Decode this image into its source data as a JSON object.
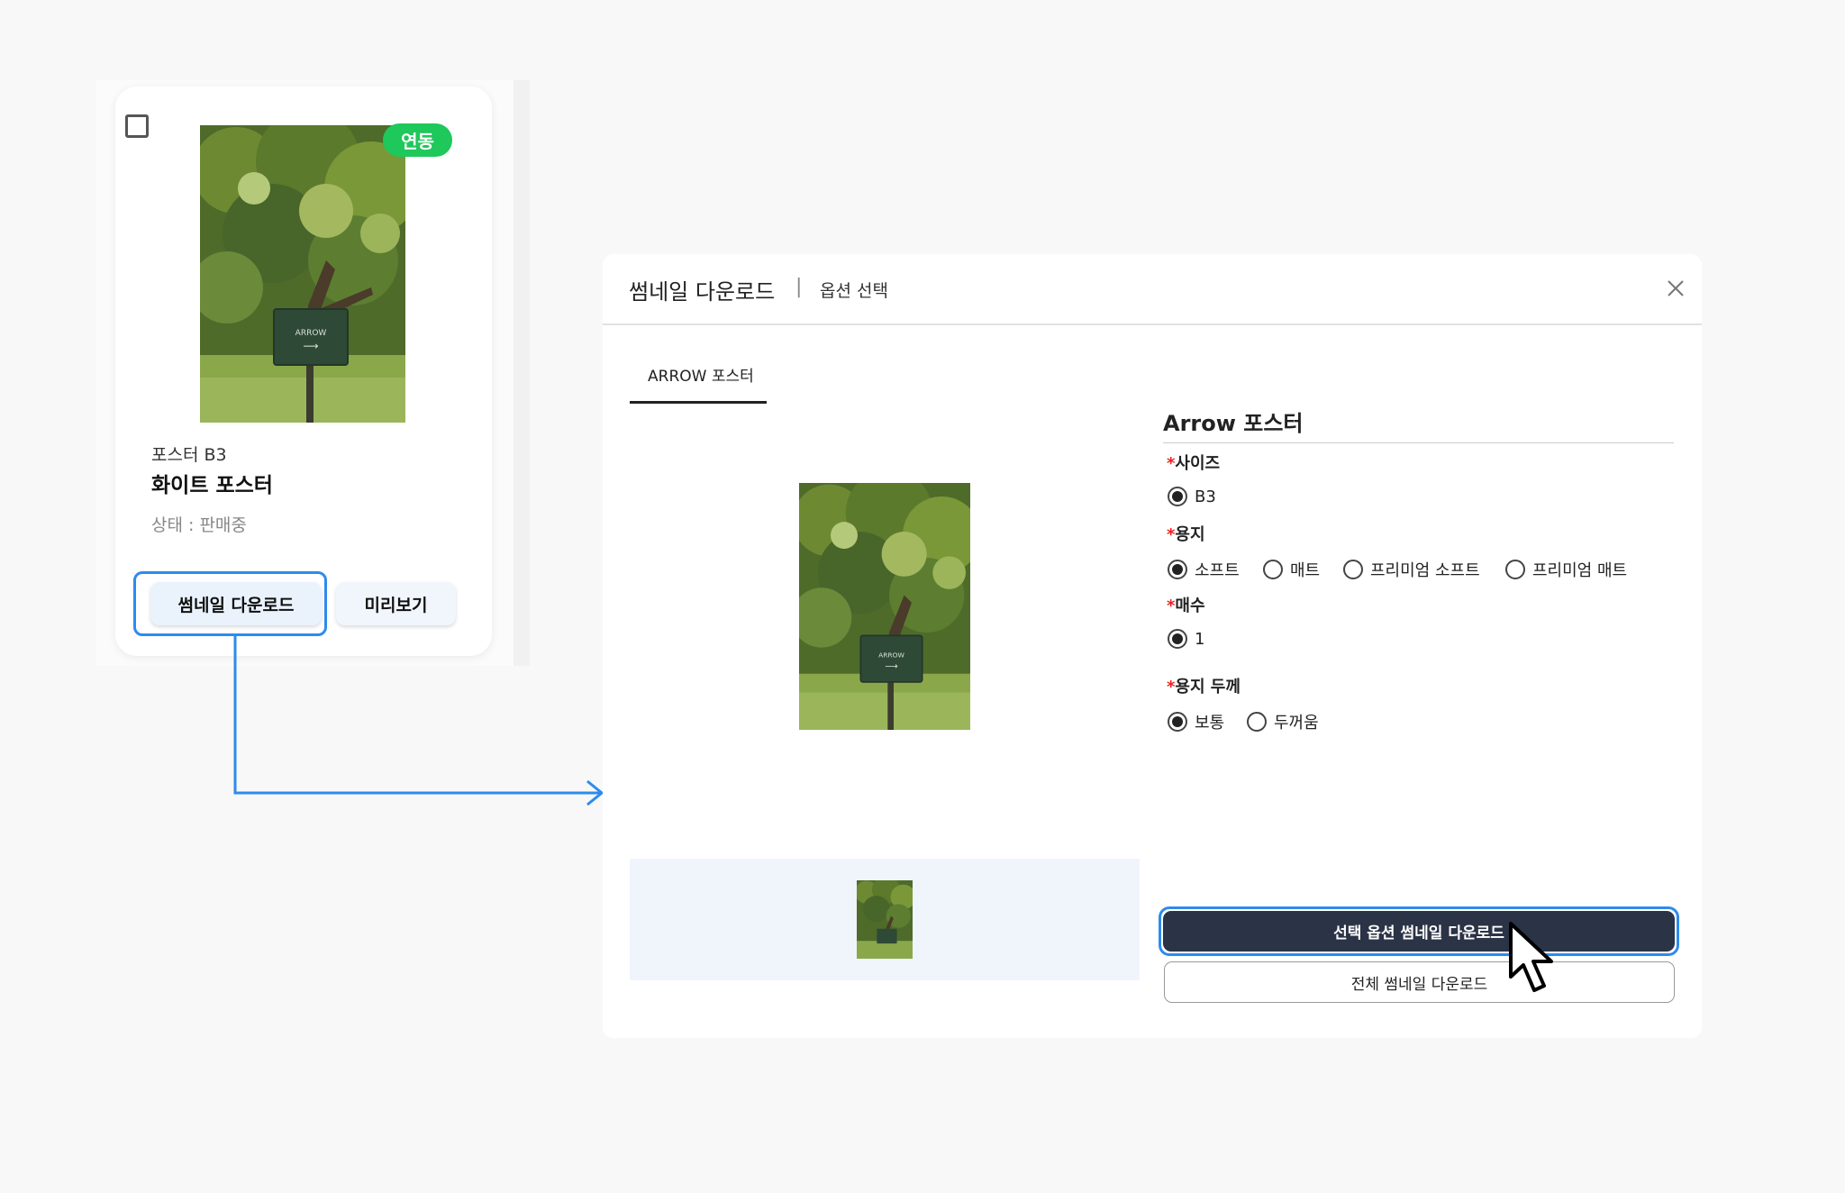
{
  "card": {
    "badge_label": "연동",
    "subtitle": "포스터 B3",
    "title": "화이트 포스터",
    "status": "상태 : 판매중",
    "thumbnail_button_label": "썸네일 다운로드",
    "preview_button_label": "미리보기",
    "image_sign_text": "ARROW",
    "image_sign_arrow": "⟶"
  },
  "modal": {
    "title": "썸네일 다운로드",
    "separator": "|",
    "subtitle": "옵션 선택",
    "tab_label": "ARROW 포스터",
    "options_heading": "Arrow 포스터",
    "required_mark": "*",
    "option_groups": [
      {
        "label": "사이즈",
        "options": [
          "B3"
        ],
        "selected": 0
      },
      {
        "label": "용지",
        "options": [
          "소프트",
          "매트",
          "프리미엄 소프트",
          "프리미엄 매트"
        ],
        "selected": 0
      },
      {
        "label": "매수",
        "options": [
          "1"
        ],
        "selected": 0
      },
      {
        "label": "용지 두께",
        "options": [
          "보통",
          "두꺼움"
        ],
        "selected": 0
      }
    ],
    "selected_download_label": "선택 옵션 썸네일 다운로드",
    "all_download_label": "전체 썸네일 다운로드",
    "image_sign_text": "ARROW",
    "image_sign_arrow": "⟶"
  },
  "colors": {
    "badge_green": "#1ec85a",
    "highlight_blue": "#2d8bee",
    "primary_dark": "#2b3346"
  }
}
